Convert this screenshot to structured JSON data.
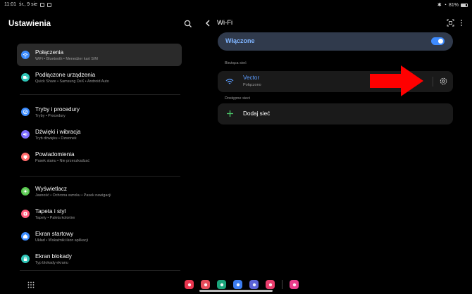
{
  "status_bar": {
    "time": "11:01",
    "date": "śr., 9 sie",
    "battery": "81%"
  },
  "left_panel": {
    "title": "Ustawienia",
    "groups": [
      [
        {
          "label": "Połączenia",
          "sub": "WiFi  •  Bluetooth  •  Menedżer kart SIM",
          "icon": "wifi-icon",
          "color": "#3b8cff",
          "active": true
        },
        {
          "label": "Podłączone urządzenia",
          "sub": "Quick Share  •  Samsung DeX  •  Android Auto",
          "icon": "devices-icon",
          "color": "#2ec4b6",
          "active": false
        }
      ],
      [
        {
          "label": "Tryby i procedury",
          "sub": "Tryby  •  Procedury",
          "icon": "modes-icon",
          "color": "#3b8cff",
          "active": false
        },
        {
          "label": "Dźwięki i wibracja",
          "sub": "Tryb dźwięku  •  Dzwonek",
          "icon": "sound-icon",
          "color": "#7c6cff",
          "active": false
        },
        {
          "label": "Powiadomienia",
          "sub": "Pasek stanu  •  Nie przeszkadzać",
          "icon": "bell-icon",
          "color": "#ff6b6b",
          "active": false
        }
      ],
      [
        {
          "label": "Wyświetlacz",
          "sub": "Jasność  •  Ochrona wzroku  •  Pasek nawigacji",
          "icon": "sun-icon",
          "color": "#57c84d",
          "active": false
        },
        {
          "label": "Tapeta i styl",
          "sub": "Tapety  •  Paleta kolorów",
          "icon": "palette-icon",
          "color": "#ff5a7a",
          "active": false
        },
        {
          "label": "Ekran startowy",
          "sub": "Układ  •  Wskaźniki ikon aplikacji",
          "icon": "home-icon",
          "color": "#3b8cff",
          "active": false
        },
        {
          "label": "Ekran blokady",
          "sub": "Typ blokady ekranu",
          "icon": "lock-icon",
          "color": "#2ec4b6",
          "active": false
        }
      ]
    ]
  },
  "right_panel": {
    "title": "Wi-Fi",
    "toggle_label": "Włączone",
    "toggle_on": true,
    "current_network_label": "Bieżąca sieć",
    "current_network": {
      "name": "Vector",
      "status": "Połączono"
    },
    "available_label": "Dostępne sieci",
    "add_network_label": "Dodaj sieć"
  },
  "colors": {
    "accent": "#3e8bff",
    "annotation_arrow": "#ff0000",
    "toggle_card": "#303a4c"
  },
  "dock": {
    "apps": [
      {
        "name": "app-red",
        "color": "#e8344e"
      },
      {
        "name": "app-camera",
        "color": "#e74c5a"
      },
      {
        "name": "app-phone",
        "color": "#1aa37a"
      },
      {
        "name": "app-messages",
        "color": "#3b7cf0"
      },
      {
        "name": "app-browser",
        "color": "#5b63d8"
      },
      {
        "name": "app-gallery",
        "color": "#ea3d6d"
      },
      {
        "name": "app-flower",
        "color": "#ea3d8c"
      }
    ]
  }
}
